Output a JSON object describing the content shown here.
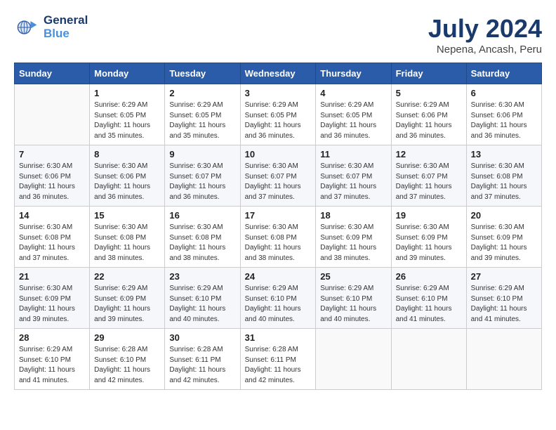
{
  "logo": {
    "text1": "General",
    "text2": "Blue"
  },
  "title": "July 2024",
  "location": "Nepena, Ancash, Peru",
  "days_of_week": [
    "Sunday",
    "Monday",
    "Tuesday",
    "Wednesday",
    "Thursday",
    "Friday",
    "Saturday"
  ],
  "weeks": [
    [
      {
        "day": "",
        "info": ""
      },
      {
        "day": "1",
        "info": "Sunrise: 6:29 AM\nSunset: 6:05 PM\nDaylight: 11 hours\nand 35 minutes."
      },
      {
        "day": "2",
        "info": "Sunrise: 6:29 AM\nSunset: 6:05 PM\nDaylight: 11 hours\nand 35 minutes."
      },
      {
        "day": "3",
        "info": "Sunrise: 6:29 AM\nSunset: 6:05 PM\nDaylight: 11 hours\nand 36 minutes."
      },
      {
        "day": "4",
        "info": "Sunrise: 6:29 AM\nSunset: 6:05 PM\nDaylight: 11 hours\nand 36 minutes."
      },
      {
        "day": "5",
        "info": "Sunrise: 6:29 AM\nSunset: 6:06 PM\nDaylight: 11 hours\nand 36 minutes."
      },
      {
        "day": "6",
        "info": "Sunrise: 6:30 AM\nSunset: 6:06 PM\nDaylight: 11 hours\nand 36 minutes."
      }
    ],
    [
      {
        "day": "7",
        "info": "Sunrise: 6:30 AM\nSunset: 6:06 PM\nDaylight: 11 hours\nand 36 minutes."
      },
      {
        "day": "8",
        "info": "Sunrise: 6:30 AM\nSunset: 6:06 PM\nDaylight: 11 hours\nand 36 minutes."
      },
      {
        "day": "9",
        "info": "Sunrise: 6:30 AM\nSunset: 6:07 PM\nDaylight: 11 hours\nand 36 minutes."
      },
      {
        "day": "10",
        "info": "Sunrise: 6:30 AM\nSunset: 6:07 PM\nDaylight: 11 hours\nand 37 minutes."
      },
      {
        "day": "11",
        "info": "Sunrise: 6:30 AM\nSunset: 6:07 PM\nDaylight: 11 hours\nand 37 minutes."
      },
      {
        "day": "12",
        "info": "Sunrise: 6:30 AM\nSunset: 6:07 PM\nDaylight: 11 hours\nand 37 minutes."
      },
      {
        "day": "13",
        "info": "Sunrise: 6:30 AM\nSunset: 6:08 PM\nDaylight: 11 hours\nand 37 minutes."
      }
    ],
    [
      {
        "day": "14",
        "info": "Sunrise: 6:30 AM\nSunset: 6:08 PM\nDaylight: 11 hours\nand 37 minutes."
      },
      {
        "day": "15",
        "info": "Sunrise: 6:30 AM\nSunset: 6:08 PM\nDaylight: 11 hours\nand 38 minutes."
      },
      {
        "day": "16",
        "info": "Sunrise: 6:30 AM\nSunset: 6:08 PM\nDaylight: 11 hours\nand 38 minutes."
      },
      {
        "day": "17",
        "info": "Sunrise: 6:30 AM\nSunset: 6:08 PM\nDaylight: 11 hours\nand 38 minutes."
      },
      {
        "day": "18",
        "info": "Sunrise: 6:30 AM\nSunset: 6:09 PM\nDaylight: 11 hours\nand 38 minutes."
      },
      {
        "day": "19",
        "info": "Sunrise: 6:30 AM\nSunset: 6:09 PM\nDaylight: 11 hours\nand 39 minutes."
      },
      {
        "day": "20",
        "info": "Sunrise: 6:30 AM\nSunset: 6:09 PM\nDaylight: 11 hours\nand 39 minutes."
      }
    ],
    [
      {
        "day": "21",
        "info": "Sunrise: 6:30 AM\nSunset: 6:09 PM\nDaylight: 11 hours\nand 39 minutes."
      },
      {
        "day": "22",
        "info": "Sunrise: 6:29 AM\nSunset: 6:09 PM\nDaylight: 11 hours\nand 39 minutes."
      },
      {
        "day": "23",
        "info": "Sunrise: 6:29 AM\nSunset: 6:10 PM\nDaylight: 11 hours\nand 40 minutes."
      },
      {
        "day": "24",
        "info": "Sunrise: 6:29 AM\nSunset: 6:10 PM\nDaylight: 11 hours\nand 40 minutes."
      },
      {
        "day": "25",
        "info": "Sunrise: 6:29 AM\nSunset: 6:10 PM\nDaylight: 11 hours\nand 40 minutes."
      },
      {
        "day": "26",
        "info": "Sunrise: 6:29 AM\nSunset: 6:10 PM\nDaylight: 11 hours\nand 41 minutes."
      },
      {
        "day": "27",
        "info": "Sunrise: 6:29 AM\nSunset: 6:10 PM\nDaylight: 11 hours\nand 41 minutes."
      }
    ],
    [
      {
        "day": "28",
        "info": "Sunrise: 6:29 AM\nSunset: 6:10 PM\nDaylight: 11 hours\nand 41 minutes."
      },
      {
        "day": "29",
        "info": "Sunrise: 6:28 AM\nSunset: 6:10 PM\nDaylight: 11 hours\nand 42 minutes."
      },
      {
        "day": "30",
        "info": "Sunrise: 6:28 AM\nSunset: 6:11 PM\nDaylight: 11 hours\nand 42 minutes."
      },
      {
        "day": "31",
        "info": "Sunrise: 6:28 AM\nSunset: 6:11 PM\nDaylight: 11 hours\nand 42 minutes."
      },
      {
        "day": "",
        "info": ""
      },
      {
        "day": "",
        "info": ""
      },
      {
        "day": "",
        "info": ""
      }
    ]
  ]
}
